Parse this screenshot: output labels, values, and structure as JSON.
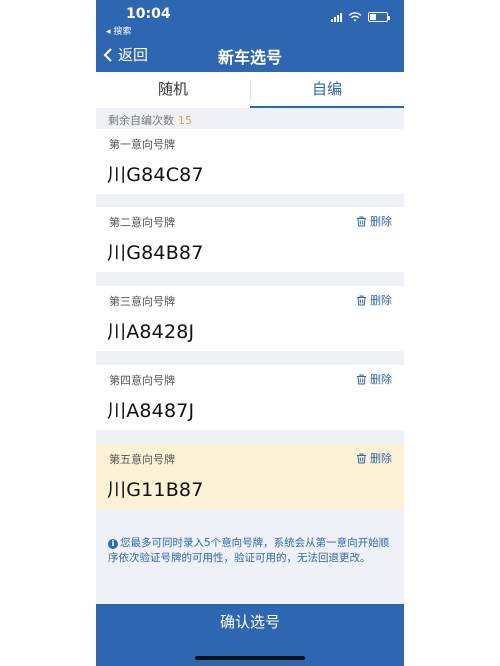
{
  "status_bar": {
    "time": "10:04",
    "back_app": "◂ 搜索"
  },
  "nav": {
    "back_label": "返回",
    "title": "新车选号"
  },
  "tabs": [
    {
      "label": "随机",
      "active": false
    },
    {
      "label": "自编",
      "active": true
    }
  ],
  "remaining": {
    "label": "剩余自编次数",
    "count": "15"
  },
  "plates": [
    {
      "label": "第一意向号牌",
      "value": "川G84C87",
      "delete_label": ""
    },
    {
      "label": "第二意向号牌",
      "value": "川G84B87",
      "delete_label": "删除"
    },
    {
      "label": "第三意向号牌",
      "value": "川A8428J",
      "delete_label": "删除"
    },
    {
      "label": "第四意向号牌",
      "value": "川A8487J",
      "delete_label": "删除"
    },
    {
      "label": "第五意向号牌",
      "value": "川G11B87",
      "delete_label": "删除"
    }
  ],
  "notice": {
    "icon": "info-icon",
    "text": "您最多可同时录入5个意向号牌，系统会从第一意向开始顺序依次验证号牌的可用性，验证可用的，无法回退更改。"
  },
  "confirm_button": {
    "label": "确认选号"
  },
  "colors": {
    "primary": "#2e67b1",
    "accent": "#e6a23c",
    "highlight": "#fdf2d5"
  }
}
